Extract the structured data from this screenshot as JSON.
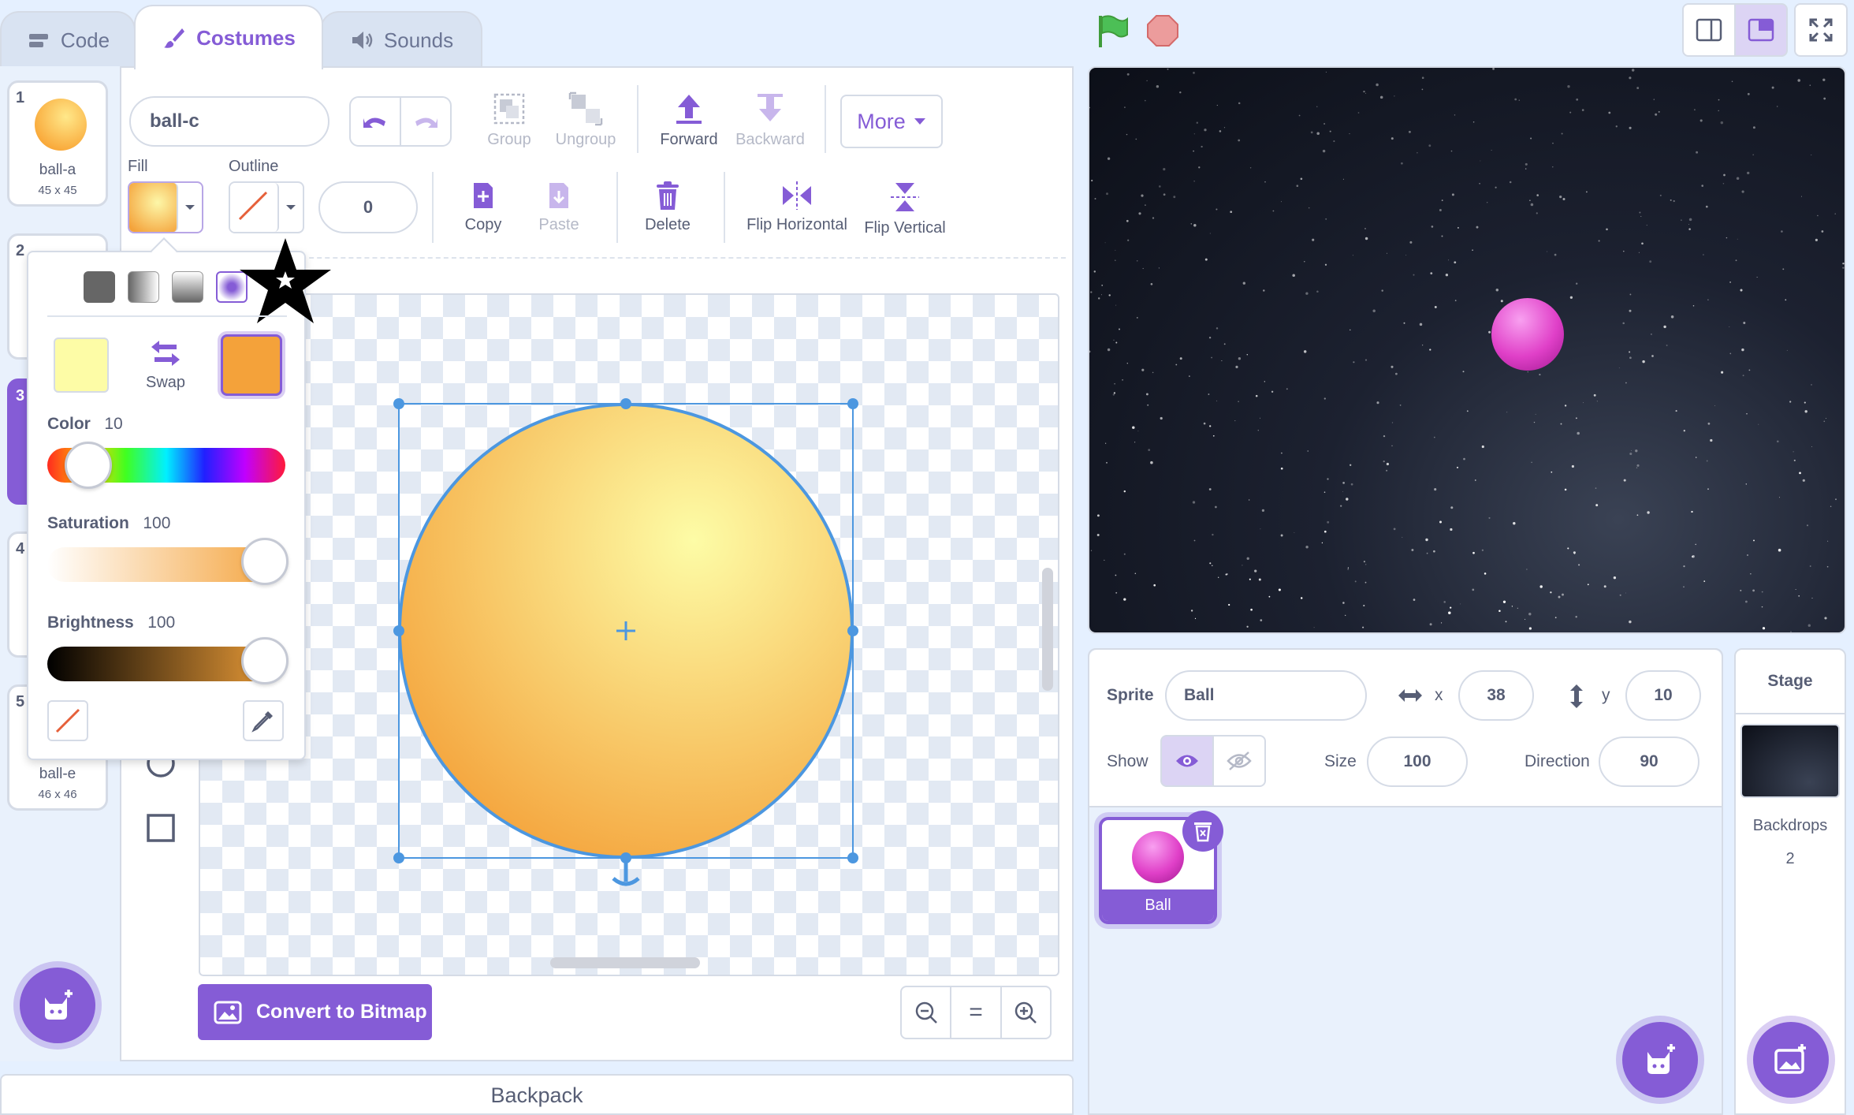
{
  "tabs": {
    "code": "Code",
    "costumes": "Costumes",
    "sounds": "Sounds"
  },
  "costumes": [
    {
      "num": "1",
      "name": "ball-a",
      "size": "45 x 45"
    },
    {
      "num": "2"
    },
    {
      "num": "3"
    },
    {
      "num": "4"
    },
    {
      "num": "5",
      "name": "ball-e",
      "size": "46 x 46"
    }
  ],
  "editor": {
    "costume_name": "ball-c",
    "fill_label": "Fill",
    "outline_label": "Outline",
    "outline_width": "0",
    "group": "Group",
    "ungroup": "Ungroup",
    "forward": "Forward",
    "backward": "Backward",
    "more": "More",
    "copy": "Copy",
    "paste": "Paste",
    "delete": "Delete",
    "flip_h": "Flip Horizontal",
    "flip_v": "Flip Vertical",
    "convert": "Convert to Bitmap",
    "zoom_reset": "="
  },
  "color_picker": {
    "swap": "Swap",
    "color_label": "Color",
    "color_value": "10",
    "saturation_label": "Saturation",
    "saturation_value": "100",
    "brightness_label": "Brightness",
    "brightness_value": "100",
    "color_level": 0.1,
    "saturation_level": 1.0,
    "brightness_level": 1.0,
    "primary_color": "#fdfca6",
    "secondary_color": "#f4a23a"
  },
  "sprite": {
    "sprite_label": "Sprite",
    "name": "Ball",
    "x_label": "x",
    "x": "38",
    "y_label": "y",
    "y": "10",
    "show_label": "Show",
    "size_label": "Size",
    "size": "100",
    "direction_label": "Direction",
    "direction": "90",
    "tile_name": "Ball"
  },
  "stage_panel": {
    "title": "Stage",
    "backdrops_label": "Backdrops",
    "backdrops_count": "2"
  },
  "backpack": "Backpack",
  "colors": {
    "accent": "#855cd6",
    "ball_fill": "#f9b540",
    "stage_ball": "#e040c8"
  }
}
